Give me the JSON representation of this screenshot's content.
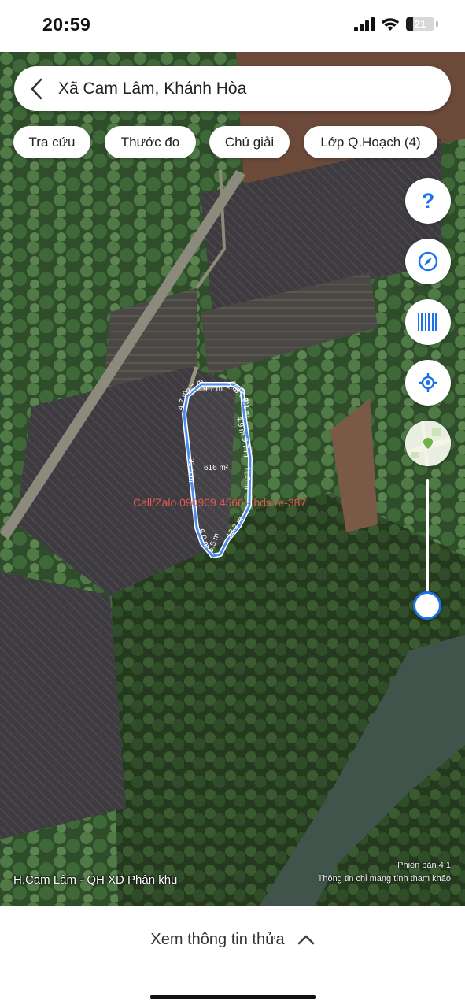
{
  "status_bar": {
    "time": "20:59",
    "battery_level": "21",
    "icons": [
      "cellular-signal-icon",
      "wifi-icon",
      "battery-icon"
    ]
  },
  "search": {
    "back_icon": "chevron-left-icon",
    "location": "Xã Cam Lâm, Khánh Hòa"
  },
  "chips": [
    {
      "label": "Tra cứu"
    },
    {
      "label": "Thước đo"
    },
    {
      "label": "Chú giải"
    },
    {
      "label": "Lớp Q.Hoạch (4)"
    }
  ],
  "map_controls": {
    "help_label": "?",
    "buttons": [
      "help-icon",
      "compass-icon",
      "barcode-icon",
      "locate-icon",
      "map-layer-icon"
    ],
    "zoom_level": 0.1
  },
  "parcel": {
    "area": "616 m²",
    "edge_labels": [
      "4.7 m",
      "2.7 m",
      "9.7 m",
      "2.6 m",
      "3.7 m",
      "6.1 m",
      "4.9 m",
      "9.7 m",
      "11.5 m",
      "12.2 m",
      "5.5 m",
      "6.0 m",
      "31.5 m"
    ],
    "outline_color": "#4a8cf0"
  },
  "map_overlays": {
    "watermark": "Call/Zalo 090909 4566 - bds.re-387",
    "plan_name": "H.Cam Lâm - QH XD Phân khu",
    "version": "Phiên bản 4.1",
    "disclaimer": "Thông tin chỉ mang tính tham khảo"
  },
  "bottom_panel": {
    "label": "Xem thông tin thửa",
    "toggle_icon": "chevron-up-icon"
  },
  "colors": {
    "accent": "#1a73e8",
    "watermark": "#e05a4f"
  }
}
